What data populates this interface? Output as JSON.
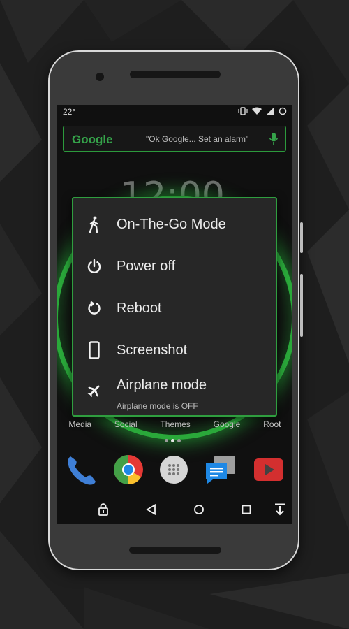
{
  "status_bar": {
    "temperature": "22°"
  },
  "search": {
    "logo_text": "Google",
    "hint": "\"Ok Google... Set an alarm\""
  },
  "clock_partial": "12:00",
  "home": {
    "categories": [
      "Media",
      "Social",
      "Themes",
      "Google",
      "Root"
    ],
    "dock": [
      "phone-icon",
      "chrome-icon",
      "app-drawer-icon",
      "messages-icon",
      "youtube-icon"
    ]
  },
  "power_menu": {
    "items": [
      {
        "label": "On-The-Go Mode",
        "icon": "walking-person-icon"
      },
      {
        "label": "Power off",
        "icon": "power-icon"
      },
      {
        "label": "Reboot",
        "icon": "reboot-icon"
      },
      {
        "label": "Screenshot",
        "icon": "phone-screenshot-icon"
      },
      {
        "label": "Airplane mode",
        "sublabel": "Airplane mode is OFF",
        "icon": "airplane-icon"
      }
    ]
  },
  "colors": {
    "accent": "#2f9e3f",
    "menu_bg": "#272727"
  }
}
